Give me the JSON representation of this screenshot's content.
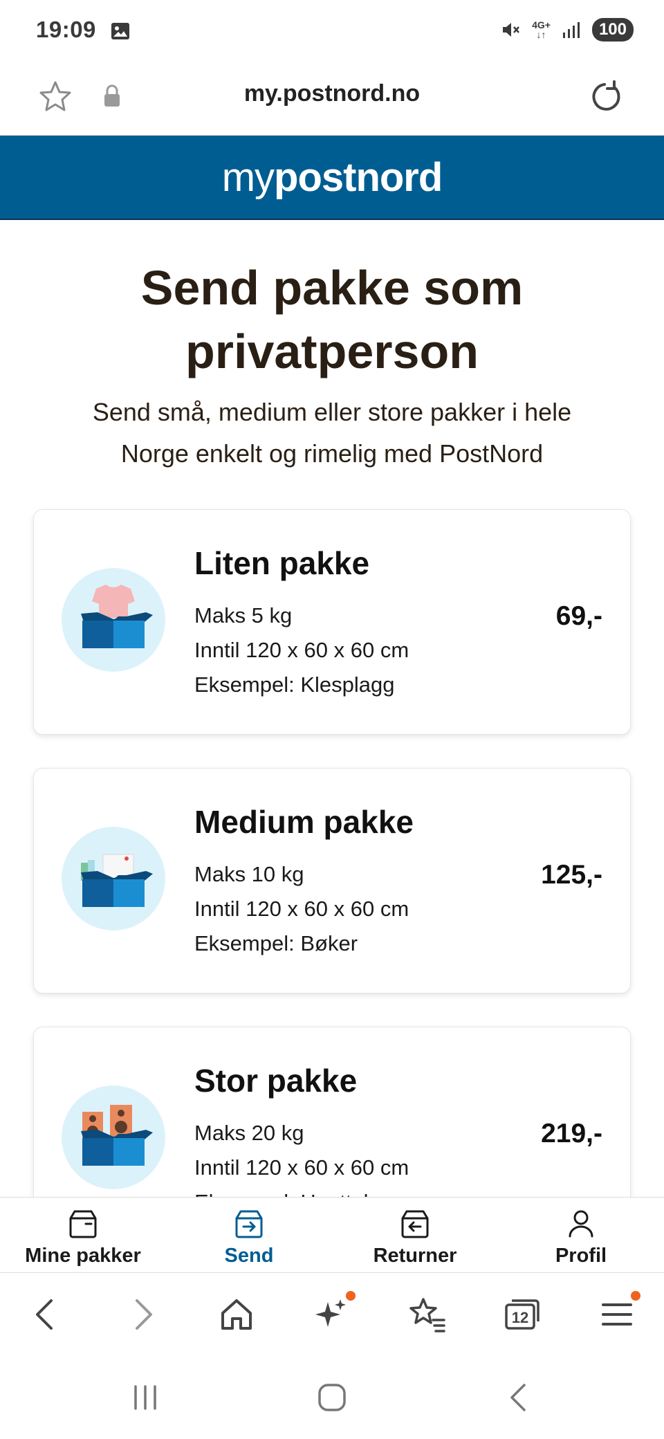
{
  "status_bar": {
    "time": "19:09",
    "battery": "100",
    "network": "4G+"
  },
  "browser": {
    "url": "my.postnord.no",
    "icons": [
      "star-icon",
      "lock-icon",
      "reload-icon"
    ]
  },
  "header": {
    "logo_my": "my",
    "logo_brand": "postnord"
  },
  "main": {
    "title": "Send pakke som privatperson",
    "subtitle": "Send små, medium eller store pakker i hele Norge enkelt og rimelig med PostNord",
    "packages": [
      {
        "name": "Liten pakke",
        "weight": "Maks 5 kg",
        "size": "Inntil 120 x 60 x 60 cm",
        "example": "Eksempel: Klesplagg",
        "price": "69,-",
        "icon": "clothing-box-icon"
      },
      {
        "name": "Medium pakke",
        "weight": "Maks 10 kg",
        "size": "Inntil 120 x 60 x 60 cm",
        "example": "Eksempel: Bøker",
        "price": "125,-",
        "icon": "books-box-icon"
      },
      {
        "name": "Stor pakke",
        "weight": "Maks 20 kg",
        "size": "Inntil 120 x 60 x 60 cm",
        "example": "Eksempel: Høyttalere",
        "price": "219,-",
        "icon": "speakers-box-icon"
      }
    ]
  },
  "app_nav": {
    "items": [
      {
        "label": "Mine pakker",
        "icon": "package-icon",
        "active": false
      },
      {
        "label": "Send",
        "icon": "send-package-icon",
        "active": true
      },
      {
        "label": "Returner",
        "icon": "return-package-icon",
        "active": false
      },
      {
        "label": "Profil",
        "icon": "person-icon",
        "active": false
      }
    ]
  },
  "browser_toolbar": {
    "tab_count": "12",
    "icons": [
      "back-icon",
      "forward-icon",
      "home-icon",
      "sparkle-icon",
      "bookmarks-icon",
      "tabs-icon",
      "menu-icon"
    ]
  },
  "colors": {
    "brand_blue": "#005d92",
    "accent_orange": "#f0621e",
    "illustration_bg": "#dcf2fb"
  }
}
